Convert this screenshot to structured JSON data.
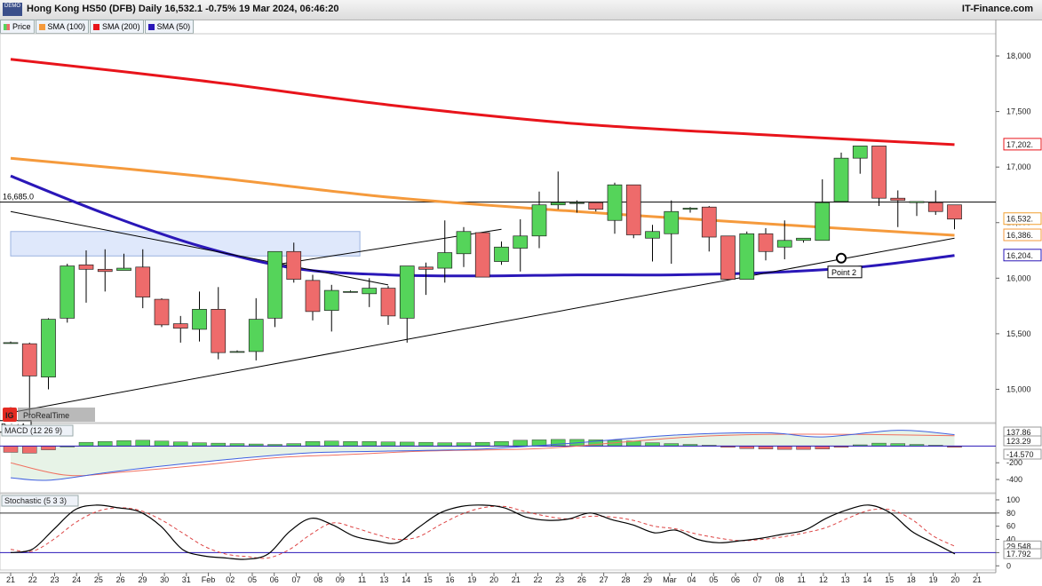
{
  "header": {
    "title": "Hong Kong HS50 (DFB) Daily 16,532.1 -0.75% 19 Mar 2024, 06:46:20",
    "brand": "IT-Finance.com",
    "demo_badge": "DEMO"
  },
  "legend": {
    "price": "Price",
    "sma100": "SMA (100)",
    "sma200": "SMA (200)",
    "sma50": "SMA (50)"
  },
  "watermark": {
    "ig": "IG",
    "text": "ProRealTime"
  },
  "annotations": {
    "horizontal_line_label": "16,685.0",
    "point1": "Point 1",
    "point2": "Point 2"
  },
  "colors": {
    "up": "#55d45a",
    "down": "#ee6b6b",
    "sma200": "#e8141b",
    "sma100": "#f59a3c",
    "sma50": "#2a17b8",
    "macd_line": "#4060e0",
    "macd_signal": "#f07060",
    "stoch_k": "#000000",
    "stoch_d": "#dd4444"
  },
  "chart_data": [
    {
      "type": "candlestick",
      "panel": "price",
      "ylim": [
        14700,
        18200
      ],
      "yticks": [
        "18,000",
        "17,500",
        "17,000",
        "16,500",
        "16,000",
        "15,500",
        "15,000"
      ],
      "ytick_values": [
        18000,
        17500,
        17000,
        16500,
        16000,
        15500,
        15000
      ],
      "price_labels": [
        {
          "text": "17,202.",
          "value": 17202,
          "color": "#e8141b"
        },
        {
          "text": "16,532.",
          "value": 16532,
          "color": "#f0a030"
        },
        {
          "text": "16,386.",
          "value": 16386,
          "color": "#f59a3c"
        },
        {
          "text": "16,204.",
          "value": 16204,
          "color": "#2a17b8"
        }
      ],
      "x_labels": [
        "21",
        "22",
        "23",
        "24",
        "25",
        "26",
        "29",
        "30",
        "31",
        "Feb",
        "02",
        "05",
        "06",
        "07",
        "08",
        "09",
        "11",
        "13",
        "14",
        "15",
        "16",
        "19",
        "20",
        "21",
        "22",
        "23",
        "26",
        "27",
        "28",
        "29",
        "Mar",
        "04",
        "05",
        "06",
        "07",
        "08",
        "11",
        "12",
        "13",
        "14",
        "15",
        "18",
        "19",
        "20",
        "21"
      ],
      "candles": [
        [
          15420,
          15430,
          15410,
          15420
        ],
        [
          15410,
          15420,
          14770,
          15120
        ],
        [
          15110,
          15640,
          15000,
          15630
        ],
        [
          15640,
          16130,
          15600,
          16110
        ],
        [
          16120,
          16250,
          15780,
          16080
        ],
        [
          16080,
          16260,
          15880,
          16060
        ],
        [
          16070,
          16220,
          16070,
          16090
        ],
        [
          16100,
          16260,
          15730,
          15830
        ],
        [
          15810,
          15820,
          15560,
          15580
        ],
        [
          15590,
          15660,
          15420,
          15550
        ],
        [
          15540,
          15880,
          15430,
          15720
        ],
        [
          15720,
          15920,
          15270,
          15330
        ],
        [
          15340,
          15350,
          15330,
          15340
        ],
        [
          15340,
          15820,
          15260,
          15630
        ],
        [
          15640,
          16240,
          15560,
          16240
        ],
        [
          16240,
          16320,
          15960,
          15990
        ],
        [
          15980,
          16030,
          15620,
          15700
        ],
        [
          15710,
          15940,
          15520,
          15890
        ],
        [
          15880,
          15890,
          15870,
          15880
        ],
        [
          15860,
          16000,
          15740,
          15910
        ],
        [
          15910,
          15930,
          15580,
          15660
        ],
        [
          15640,
          16070,
          15420,
          16110
        ],
        [
          16100,
          16140,
          15850,
          16080
        ],
        [
          16090,
          16520,
          15960,
          16230
        ],
        [
          16220,
          16460,
          16100,
          16420
        ],
        [
          16410,
          16410,
          16080,
          16010
        ],
        [
          16150,
          16330,
          16120,
          16280
        ],
        [
          16270,
          16530,
          16060,
          16380
        ],
        [
          16380,
          16780,
          16270,
          16660
        ],
        [
          16660,
          16960,
          16620,
          16680
        ],
        [
          16680,
          16700,
          16590,
          16680
        ],
        [
          16680,
          16650,
          16600,
          16620
        ],
        [
          16520,
          16860,
          16400,
          16840
        ],
        [
          16840,
          16840,
          16360,
          16390
        ],
        [
          16360,
          16480,
          16150,
          16420
        ],
        [
          16400,
          16700,
          16130,
          16600
        ],
        [
          16620,
          16640,
          16590,
          16630
        ],
        [
          16640,
          16650,
          16240,
          16370
        ],
        [
          16380,
          16360,
          16050,
          15990
        ],
        [
          15990,
          16420,
          16000,
          16400
        ],
        [
          16400,
          16450,
          16160,
          16240
        ],
        [
          16280,
          16520,
          16170,
          16340
        ],
        [
          16340,
          16340,
          16320,
          16360
        ],
        [
          16340,
          16890,
          16400,
          16680
        ],
        [
          16690,
          17130,
          16740,
          17080
        ],
        [
          17080,
          17180,
          16940,
          17190
        ],
        [
          17190,
          17170,
          16650,
          16720
        ],
        [
          16720,
          16790,
          16460,
          16700
        ],
        [
          16680,
          16690,
          16560,
          16690
        ],
        [
          16680,
          16790,
          16570,
          16600
        ],
        [
          16660,
          16660,
          16440,
          16532
        ]
      ],
      "series": [
        {
          "name": "SMA (200)",
          "points": [
            [
              0,
              17970
            ],
            [
              10,
              17780
            ],
            [
              20,
              17560
            ],
            [
              30,
              17390
            ],
            [
              40,
              17290
            ],
            [
              50,
              17202
            ]
          ]
        },
        {
          "name": "SMA (100)",
          "points": [
            [
              0,
              17080
            ],
            [
              10,
              16920
            ],
            [
              20,
              16730
            ],
            [
              30,
              16600
            ],
            [
              40,
              16490
            ],
            [
              50,
              16386
            ]
          ]
        },
        {
          "name": "SMA (50)",
          "points": [
            [
              0,
              16920
            ],
            [
              5,
              16580
            ],
            [
              10,
              16290
            ],
            [
              15,
              16090
            ],
            [
              20,
              16030
            ],
            [
              25,
              16020
            ],
            [
              30,
              16030
            ],
            [
              35,
              16030
            ],
            [
              40,
              16050
            ],
            [
              45,
              16100
            ],
            [
              50,
              16204
            ]
          ]
        }
      ],
      "horizontal_line": 16685,
      "trendlines": [
        {
          "from": [
            0,
            16600
          ],
          "to": [
            20,
            15940
          ]
        },
        {
          "from": [
            14,
            16120
          ],
          "to": [
            26,
            16440
          ]
        },
        {
          "from": [
            0,
            14790
          ],
          "to": [
            50,
            16360
          ]
        }
      ],
      "highlight_box": {
        "x": [
          0,
          18.5
        ],
        "y": [
          16200,
          16420
        ]
      },
      "points": [
        {
          "label": "Point 1",
          "at": [
            0,
            14790
          ]
        },
        {
          "label": "Point 2",
          "at": [
            44,
            16180
          ]
        }
      ]
    },
    {
      "type": "bar",
      "panel": "macd",
      "title": "MACD (12 26 9)",
      "ylim": [
        -560,
        260
      ],
      "yticks": [
        "-200",
        "-400"
      ],
      "ytick_values": [
        -200,
        -400
      ],
      "value_labels": [
        {
          "text": "137.86",
          "value": 137.86
        },
        {
          "text": "123.29",
          "value": 123.29
        },
        {
          "text": "-14.570",
          "value": -14.57
        }
      ],
      "histogram": [
        -75,
        -85,
        -45,
        0,
        45,
        55,
        65,
        70,
        60,
        50,
        40,
        35,
        30,
        25,
        20,
        30,
        55,
        60,
        55,
        55,
        50,
        48,
        45,
        40,
        40,
        45,
        55,
        70,
        75,
        80,
        80,
        75,
        70,
        60,
        40,
        30,
        20,
        10,
        -15,
        -30,
        -35,
        -40,
        -40,
        -35,
        -15,
        15,
        35,
        30,
        20,
        10,
        -14.57
      ],
      "series": [
        {
          "name": "MACD",
          "points": [
            [
              0,
              -380
            ],
            [
              2,
              -410
            ],
            [
              5,
              -320
            ],
            [
              8,
              -240
            ],
            [
              12,
              -150
            ],
            [
              16,
              -80
            ],
            [
              20,
              -60
            ],
            [
              25,
              -35
            ],
            [
              30,
              40
            ],
            [
              35,
              130
            ],
            [
              40,
              160
            ],
            [
              43,
              110
            ],
            [
              47,
              190
            ],
            [
              50,
              137.86
            ]
          ]
        },
        {
          "name": "Signal",
          "points": [
            [
              0,
              -200
            ],
            [
              3,
              -350
            ],
            [
              6,
              -310
            ],
            [
              10,
              -230
            ],
            [
              14,
              -140
            ],
            [
              18,
              -100
            ],
            [
              22,
              -60
            ],
            [
              28,
              -30
            ],
            [
              32,
              40
            ],
            [
              36,
              110
            ],
            [
              40,
              140
            ],
            [
              45,
              140
            ],
            [
              50,
              123.29
            ]
          ]
        }
      ]
    },
    {
      "type": "line",
      "panel": "stochastic",
      "title": "Stochastic (5 3 3)",
      "ylim": [
        -5,
        108
      ],
      "yticks": [
        "100",
        "80",
        "60",
        "40",
        "20",
        "0"
      ],
      "ytick_values": [
        100,
        80,
        60,
        40,
        20,
        0
      ],
      "value_labels": [
        {
          "text": "29.548",
          "value": 29.548
        },
        {
          "text": "17.792",
          "value": 17.792
        }
      ],
      "levels": [
        80,
        20
      ],
      "series": [
        {
          "name": "%K",
          "values": [
            20,
            25,
            55,
            85,
            92,
            88,
            82,
            60,
            25,
            15,
            12,
            10,
            18,
            52,
            72,
            62,
            45,
            38,
            35,
            58,
            80,
            90,
            92,
            88,
            74,
            69,
            71,
            80,
            70,
            62,
            50,
            54,
            40,
            35,
            38,
            42,
            48,
            54,
            72,
            85,
            92,
            80,
            52,
            35,
            18
          ]
        },
        {
          "name": "%D",
          "values": [
            25,
            22,
            40,
            65,
            82,
            88,
            84,
            70,
            50,
            30,
            18,
            14,
            12,
            25,
            48,
            65,
            58,
            48,
            40,
            44,
            62,
            78,
            88,
            90,
            82,
            75,
            71,
            75,
            74,
            69,
            60,
            56,
            48,
            42,
            38,
            40,
            44,
            50,
            58,
            72,
            84,
            85,
            70,
            45,
            29.548
          ]
        }
      ]
    }
  ]
}
